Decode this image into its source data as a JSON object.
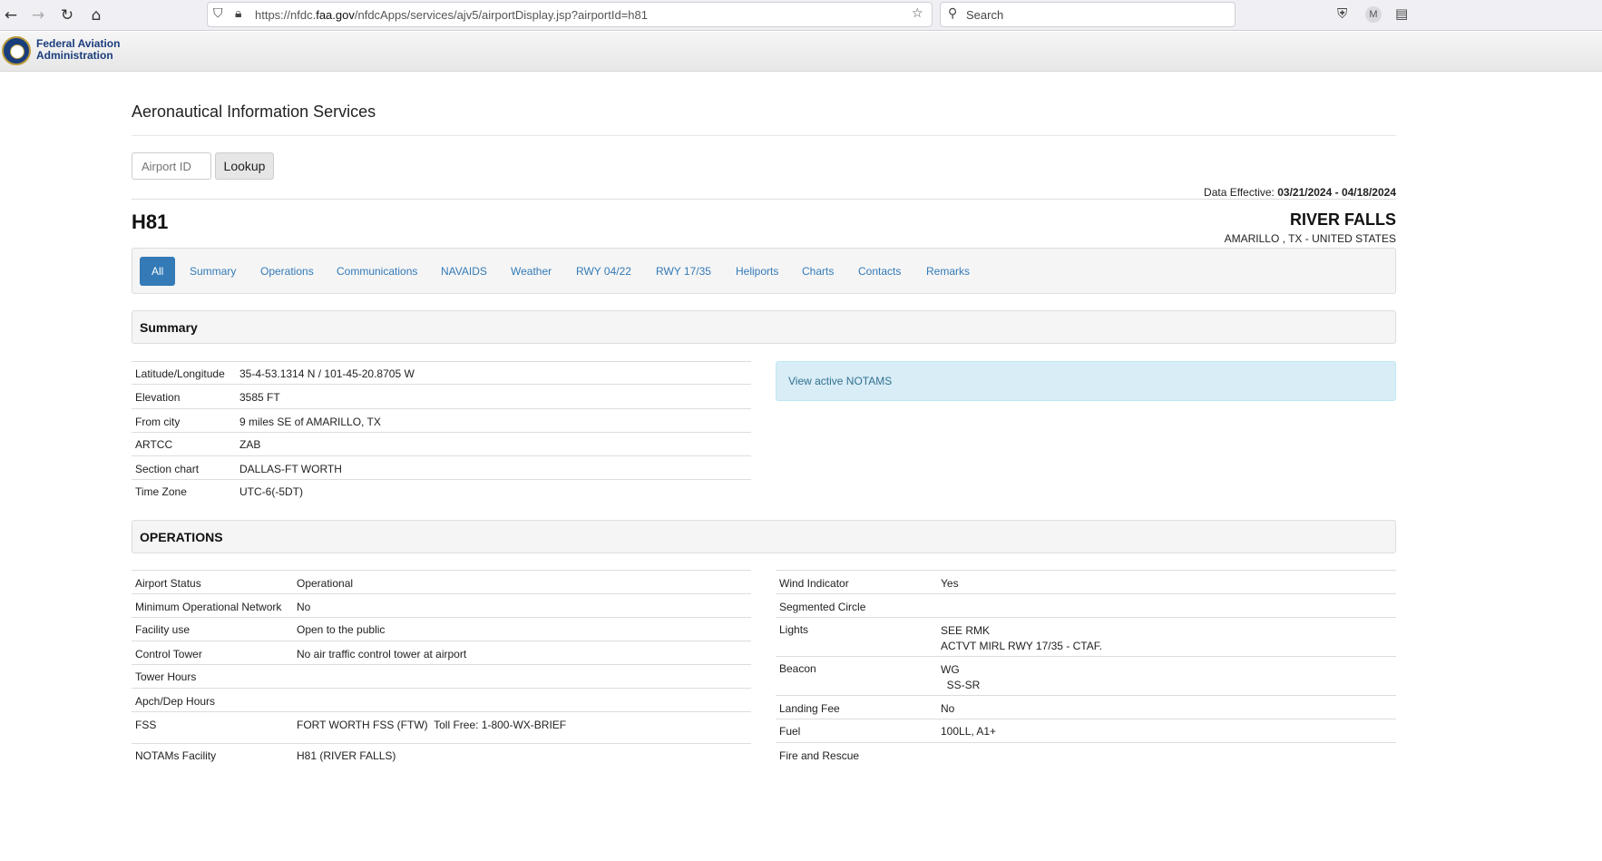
{
  "browser": {
    "url_prefix": "https://nfdc.",
    "url_domain": "faa.gov",
    "url_suffix": "/nfdcApps/services/ajv5/airportDisplay.jsp?airportId=h81",
    "search_placeholder": "Search",
    "profile_initial": "M"
  },
  "header": {
    "org_line1": "Federal Aviation",
    "org_line2": "Administration"
  },
  "page": {
    "title": "Aeronautical Information Services",
    "lookup_placeholder": "Airport ID",
    "lookup_button": "Lookup",
    "data_effective_label": "Data Effective:",
    "data_effective_value": "03/21/2024 - 04/18/2024"
  },
  "airport": {
    "id": "H81",
    "name": "RIVER FALLS",
    "location": "AMARILLO , TX - UNITED STATES"
  },
  "tabs": [
    "All",
    "Summary",
    "Operations",
    "Communications",
    "NAVAIDS",
    "Weather",
    "RWY 04/22",
    "RWY 17/35",
    "Heliports",
    "Charts",
    "Contacts",
    "Remarks"
  ],
  "summary": {
    "heading": "Summary",
    "rows": [
      [
        "Latitude/Longitude",
        "35-4-53.1314 N / 101-45-20.8705 W"
      ],
      [
        "Elevation",
        "3585 FT"
      ],
      [
        "From city",
        "9 miles SE of AMARILLO, TX"
      ],
      [
        "ARTCC",
        "ZAB"
      ],
      [
        "Section chart",
        "DALLAS-FT WORTH"
      ],
      [
        "Time Zone",
        "UTC-6(-5DT)"
      ]
    ],
    "notams_link": "View active NOTAMS"
  },
  "operations": {
    "heading": "OPERATIONS",
    "left_rows": [
      [
        "Airport Status",
        "Operational"
      ],
      [
        "Minimum Operational Network",
        "No"
      ],
      [
        "Facility use",
        "Open to the public"
      ],
      [
        "Control Tower",
        "No air traffic control tower at airport"
      ],
      [
        "Tower Hours",
        ""
      ],
      [
        "Apch/Dep Hours",
        ""
      ],
      [
        "FSS",
        "FORT WORTH FSS (FTW)  Toll Free: 1-800-WX-BRIEF"
      ],
      [
        "NOTAMs Facility",
        "H81 (RIVER FALLS)"
      ]
    ],
    "right_rows": [
      [
        "Wind Indicator",
        "Yes"
      ],
      [
        "Segmented Circle",
        ""
      ],
      [
        "Lights",
        "SEE RMK",
        "ACTVT MIRL RWY 17/35 - CTAF."
      ],
      [
        "Beacon",
        "WG",
        "  SS-SR"
      ],
      [
        "Landing Fee",
        "No"
      ],
      [
        "Fuel",
        "100LL, A1+"
      ],
      [
        "Fire and Rescue",
        ""
      ]
    ]
  }
}
